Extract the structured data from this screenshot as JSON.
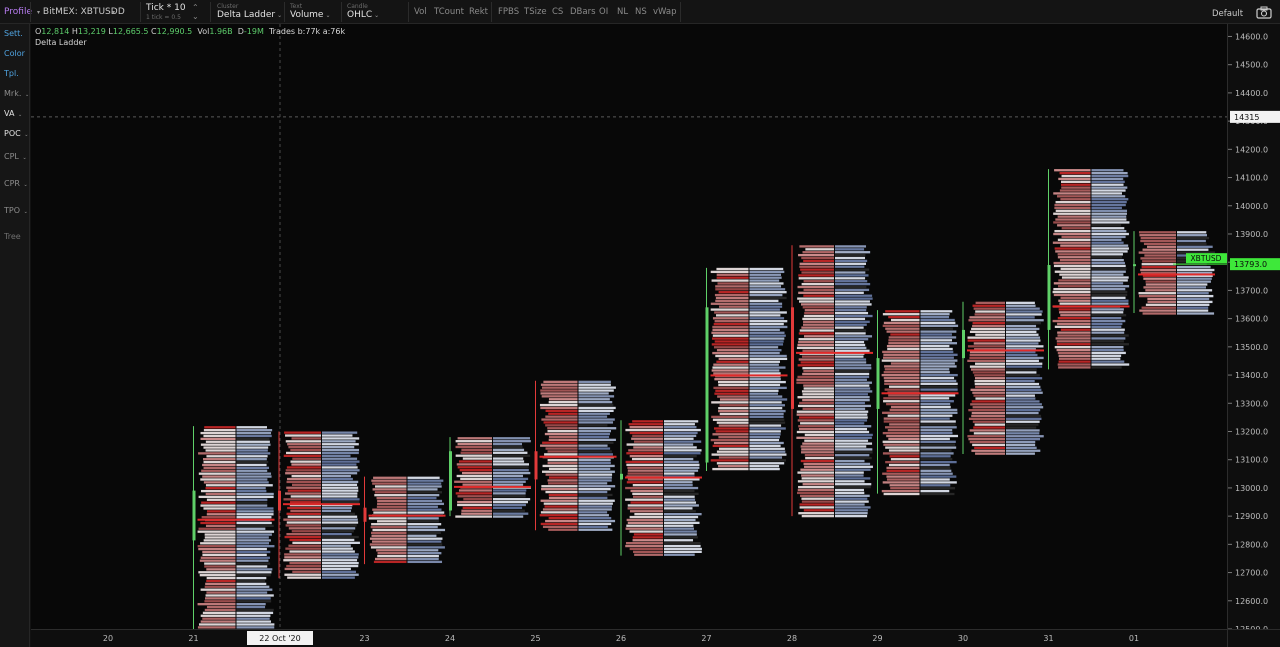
{
  "toolbar": {
    "profile": "Profile",
    "symbol": "BitMEX: XBTUSD",
    "timeframe": "D",
    "tick_value": "Tick * 10",
    "tick_note": "1 tick = 0.5",
    "cluster_label": "Cluster",
    "cluster_value": "Delta Ladder",
    "text_label": "Text",
    "text_value": "Volume",
    "candle_label": "Candle",
    "candle_value": "OHLC",
    "toggles_a": [
      "Vol",
      "TCount",
      "Rekt"
    ],
    "toggles_b": [
      "FPBS",
      "TSize",
      "CS",
      "DBars",
      "OI",
      "NL",
      "NS",
      "vWap"
    ],
    "layout": "Default"
  },
  "sidebar": {
    "items": [
      "Sett.",
      "Color",
      "Tpl.",
      "Mrk.",
      "VA",
      "POC",
      "CPL",
      "CPR",
      "TPO",
      "Tree"
    ]
  },
  "legend": {
    "o_label": "O",
    "o_value": "12,814",
    "h_label": "H",
    "h_value": "13,219",
    "l_label": "L",
    "l_value": "12,665.5",
    "c_label": "C",
    "c_value": "12,990.5",
    "vol_label": "Vol",
    "vol_value": "1.96B",
    "d_label": "D",
    "d_value": "-19M",
    "trades": "Trades b:77k a:76k",
    "study": "Delta Ladder"
  },
  "colors": {
    "up": "#5fd068",
    "down": "#e23a3a",
    "bid": "#e8a9a9",
    "ask": "#a7bbe0",
    "crosshair_label_bg": "#f2f2f2",
    "last_price_bg": "#3ee83a"
  },
  "crosshair": {
    "price_label": "14315",
    "date_label": "22 Oct '20"
  },
  "last_price": {
    "symbol": "XBTUSD",
    "price": "13793.0",
    "value": 13793
  },
  "chart_data": {
    "type": "footprint",
    "title": "Delta Ladder",
    "y_ticks": [
      14600,
      14500,
      14400,
      14300,
      14200,
      14100,
      14000,
      13900,
      13800,
      13700,
      13600,
      13500,
      13400,
      13300,
      13200,
      13100,
      13000,
      12900,
      12800,
      12700,
      12600,
      12500
    ],
    "y_tick_labels": [
      "14600.0",
      "14500.0",
      "14400.0",
      "14300.0",
      "14200.0",
      "14100.0",
      "14000.0",
      "13900.0",
      "13800.0",
      "13700.0",
      "13600.0",
      "13500.0",
      "13400.0",
      "13300.0",
      "13200.0",
      "13100.0",
      "13000.0",
      "12900.0",
      "12800.0",
      "12700.0",
      "12600.0",
      "12500.0"
    ],
    "ylim": [
      12500,
      14630
    ],
    "x_labels": [
      "20",
      "21",
      "22 Oct '20",
      "23",
      "24",
      "25",
      "26",
      "27",
      "28",
      "29",
      "30",
      "31",
      "01"
    ],
    "candles": [
      {
        "date": "21",
        "open": 12814,
        "high": 13219,
        "low": 12500,
        "close": 12990.5
      },
      {
        "date": "22",
        "open": 12990,
        "high": 13200,
        "low": 12680,
        "close": 12920
      },
      {
        "date": "23",
        "open": 12930,
        "high": 13040,
        "low": 12730,
        "close": 12880
      },
      {
        "date": "24",
        "open": 12920,
        "high": 13180,
        "low": 12900,
        "close": 13130
      },
      {
        "date": "25",
        "open": 13130,
        "high": 13380,
        "low": 12850,
        "close": 13030
      },
      {
        "date": "26",
        "open": 13030,
        "high": 13240,
        "low": 12760,
        "close": 13050
      },
      {
        "date": "27",
        "open": 13090,
        "high": 13780,
        "low": 13060,
        "close": 13640
      },
      {
        "date": "28",
        "open": 13640,
        "high": 13860,
        "low": 12900,
        "close": 13280
      },
      {
        "date": "29",
        "open": 13280,
        "high": 13630,
        "low": 12980,
        "close": 13460
      },
      {
        "date": "30",
        "open": 13460,
        "high": 13660,
        "low": 13120,
        "close": 13560
      },
      {
        "date": "31",
        "open": 13560,
        "high": 14130,
        "low": 13420,
        "close": 13790
      },
      {
        "date": "01",
        "open": 13790,
        "high": 13910,
        "low": 13620,
        "close": 13793
      }
    ]
  }
}
